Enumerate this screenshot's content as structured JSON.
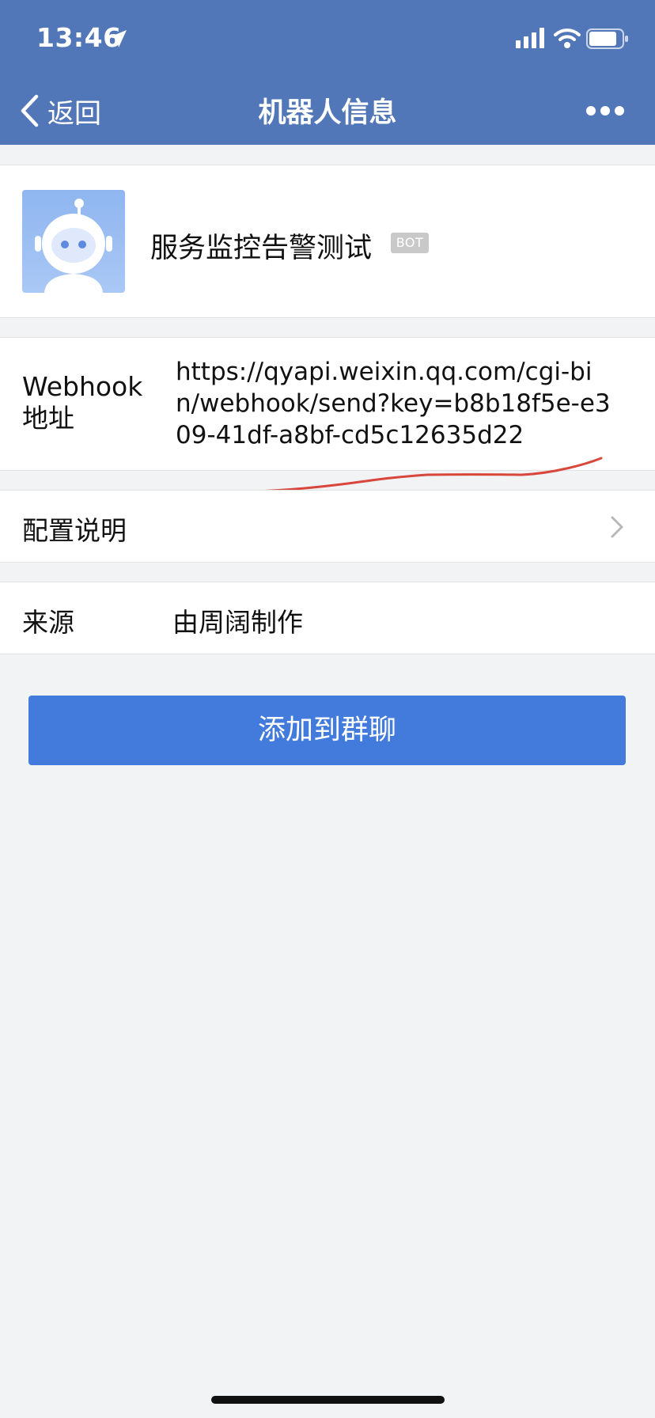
{
  "status_bar": {
    "time": "13:46"
  },
  "nav": {
    "back_label": "返回",
    "title": "机器人信息"
  },
  "profile": {
    "name": "服务监控告警测试",
    "badge": "BOT"
  },
  "webhook": {
    "label": "Webhook 地址",
    "value": "https://qyapi.weixin.qq.com/cgi-bin/webhook/send?key=b8b18f5e-e309-41df-a8bf-cd5c12635d22"
  },
  "config": {
    "label": "配置说明"
  },
  "source": {
    "label": "来源",
    "value": "由周阔制作"
  },
  "actions": {
    "add_to_group": "添加到群聊"
  },
  "colors": {
    "header": "#5277b8",
    "primary_button": "#437bdc",
    "annotation": "#d9463b"
  }
}
